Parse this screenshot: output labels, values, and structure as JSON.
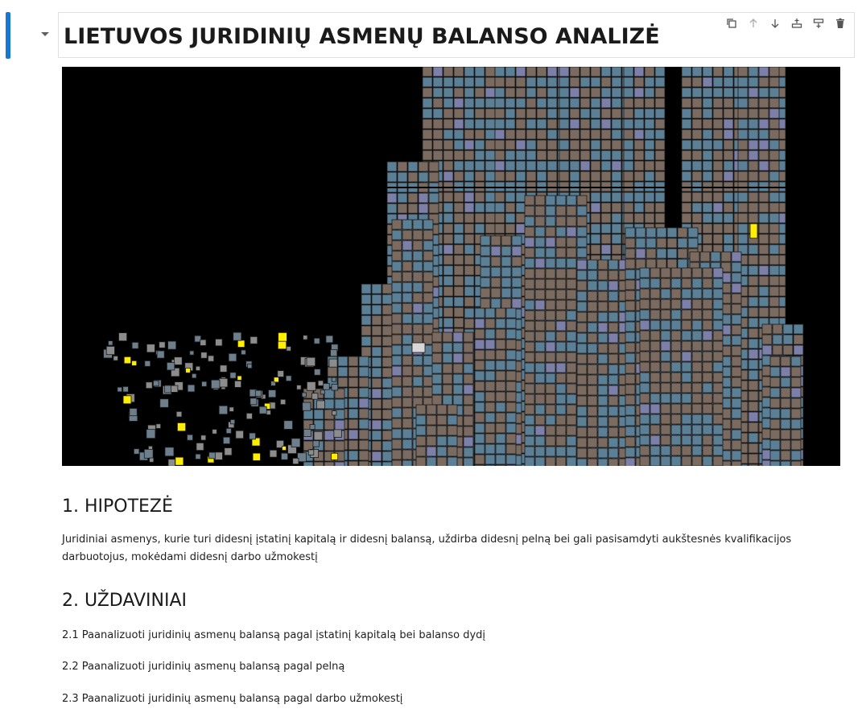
{
  "notebook": {
    "title": "LIETUVOS JURIDINIŲ ASMENŲ BALANSO ANALIZĖ",
    "toolbar": [
      {
        "icon": "duplicate-icon"
      },
      {
        "icon": "move-up-icon"
      },
      {
        "icon": "move-down-icon"
      },
      {
        "icon": "insert-above-icon"
      },
      {
        "icon": "insert-below-icon"
      },
      {
        "icon": "delete-icon"
      }
    ]
  },
  "sections": {
    "hypothesis": {
      "heading": "1. HIPOTEZĖ",
      "text": "Juridiniai asmenys, kurie turi didesnį įstatinį kapitalą ir didesnį balansą, uždirba didesnį pelną bei gali pasisamdyti aukštesnės kvalifikacijos darbuotojus, mokėdami didesnį darbo užmokestį"
    },
    "tasks": {
      "heading": "2. UŽDAVINIAI",
      "items": [
        "2.1 Paanalizuoti juridinių asmenų balansą pagal įstatinį kapitalą bei balanso dydį",
        "2.2 Paanalizuoti juridinių asmenų balansą pagal pelną",
        "2.3 Paanalizuoti juridinių asmenų balansą pagal darbo užmokestį"
      ]
    }
  },
  "colors": {
    "accent": "#1976d2",
    "cube_brown": "#7a6a5f",
    "cube_blue": "#5b7f95",
    "cube_lilac": "#7c7fa8",
    "cube_highlight": "#ffee00"
  }
}
